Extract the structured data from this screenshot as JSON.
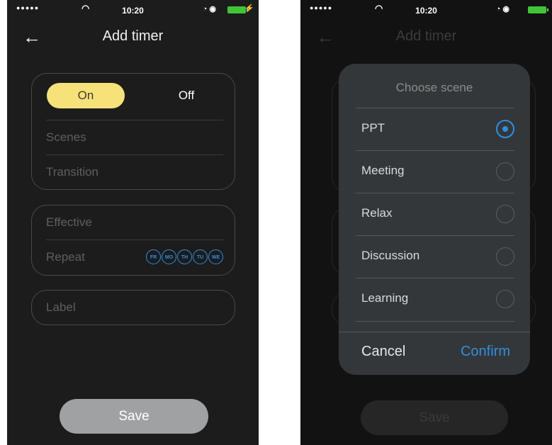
{
  "status_bar": {
    "signal": "●●●●●",
    "time": "10:20"
  },
  "left_screen": {
    "title": "Add timer",
    "toggle": {
      "on_label": "On",
      "off_label": "Off"
    },
    "rows": {
      "scenes": "Scenes",
      "transition": "Transition",
      "effective": "Effective",
      "repeat": "Repeat",
      "label": "Label"
    },
    "repeat_days": [
      "FR",
      "MO",
      "TH",
      "TU",
      "WE"
    ],
    "save_label": "Save"
  },
  "right_screen": {
    "title": "Add timer",
    "dialog": {
      "title": "Choose scene",
      "options": [
        {
          "label": "PPT",
          "selected": true
        },
        {
          "label": "Meeting",
          "selected": false
        },
        {
          "label": "Relax",
          "selected": false
        },
        {
          "label": "Discussion",
          "selected": false
        },
        {
          "label": "Learning",
          "selected": false
        }
      ],
      "cancel_label": "Cancel",
      "confirm_label": "Confirm"
    },
    "save_label": "Save"
  },
  "colors": {
    "accent_blue": "#2e8fe0",
    "toggle_yellow": "#f7e27a",
    "battery_green": "#3fc537"
  }
}
